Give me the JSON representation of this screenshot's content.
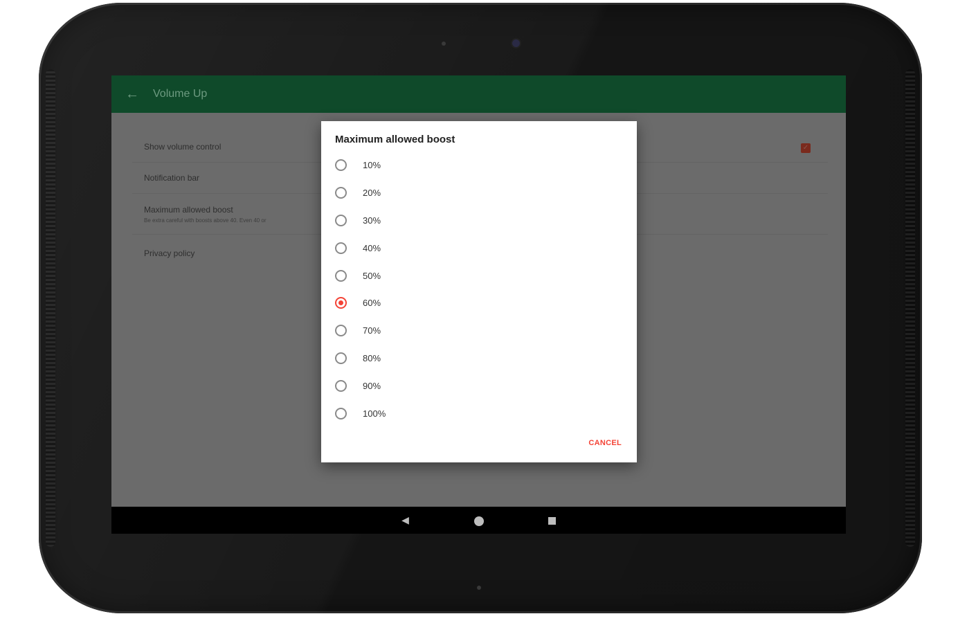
{
  "app": {
    "title": "Volume Up",
    "back_icon": "arrow-left-icon",
    "accent_color": "#f44336",
    "toolbar_color": "#0f4a2a"
  },
  "preferences": [
    {
      "title": "Show volume control",
      "summary": "",
      "checked": true
    },
    {
      "title": "Notification bar",
      "summary": ""
    },
    {
      "title": "Maximum allowed boost",
      "summary": "Be extra careful with boosts above 40. Even 40 or"
    },
    {
      "title": "Privacy policy",
      "summary": ""
    }
  ],
  "dialog": {
    "title": "Maximum allowed boost",
    "options": [
      {
        "label": "10%",
        "checked": false
      },
      {
        "label": "20%",
        "checked": false
      },
      {
        "label": "30%",
        "checked": false
      },
      {
        "label": "40%",
        "checked": false
      },
      {
        "label": "50%",
        "checked": false
      },
      {
        "label": "60%",
        "checked": true
      },
      {
        "label": "70%",
        "checked": false
      },
      {
        "label": "80%",
        "checked": false
      },
      {
        "label": "90%",
        "checked": false
      },
      {
        "label": "100%",
        "checked": false
      }
    ],
    "cancel_label": "CANCEL"
  },
  "navbar": {
    "back_icon": "nav-back-icon",
    "home_icon": "nav-home-icon",
    "recents_icon": "nav-recents-icon"
  }
}
